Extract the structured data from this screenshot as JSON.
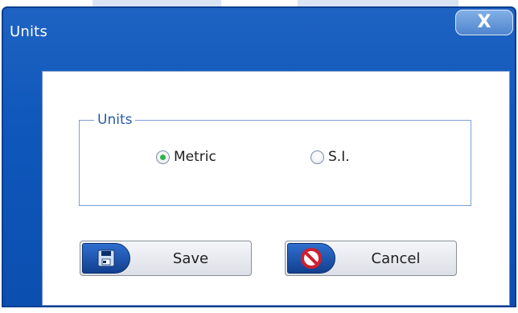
{
  "dialog": {
    "title": "Units",
    "close_symbol": "X",
    "close_icon": "close-icon"
  },
  "group": {
    "legend": "Units",
    "options": [
      {
        "label": "Metric",
        "selected": true
      },
      {
        "label": "S.I.",
        "selected": false
      }
    ]
  },
  "buttons": {
    "save_label": "Save",
    "save_icon": "floppy-disk-icon",
    "cancel_label": "Cancel",
    "cancel_icon": "no-entry-icon"
  },
  "colors": {
    "frame_blue": "#0f57bb",
    "group_border": "#7aa0d6",
    "legend_text": "#2b5aa8",
    "radio_selected": "#34b24a",
    "cancel_red": "#d11f2e"
  }
}
